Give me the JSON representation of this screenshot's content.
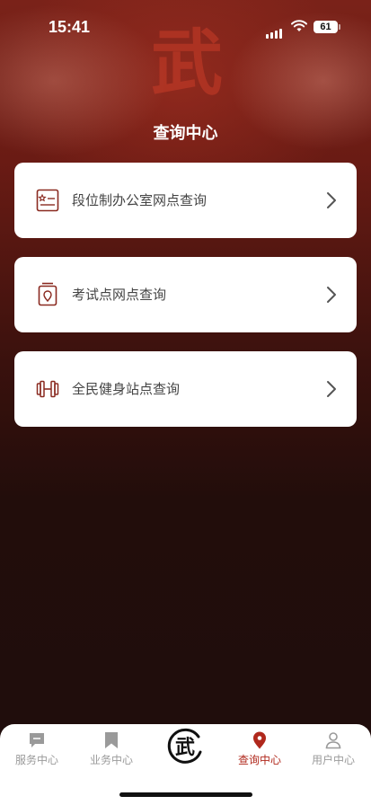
{
  "status": {
    "time": "15:41",
    "battery": "61"
  },
  "page": {
    "title": "查询中心"
  },
  "cards": [
    {
      "label": "段位制办公室网点查询",
      "icon": "certificate-icon"
    },
    {
      "label": "考试点网点查询",
      "icon": "location-pin-icon"
    },
    {
      "label": "全民健身站点查询",
      "icon": "dumbbell-icon"
    }
  ],
  "tabs": [
    {
      "label": "服务中心",
      "icon": "chat-icon",
      "active": false
    },
    {
      "label": "业务中心",
      "icon": "bookmark-icon",
      "active": false
    },
    {
      "label": "查询中心",
      "icon": "location-pin-icon",
      "active": true
    },
    {
      "label": "用户中心",
      "icon": "user-icon",
      "active": false
    }
  ],
  "logo_char": "武",
  "colors": {
    "accent": "#b0281c",
    "card_icon": "#8a2a20"
  }
}
